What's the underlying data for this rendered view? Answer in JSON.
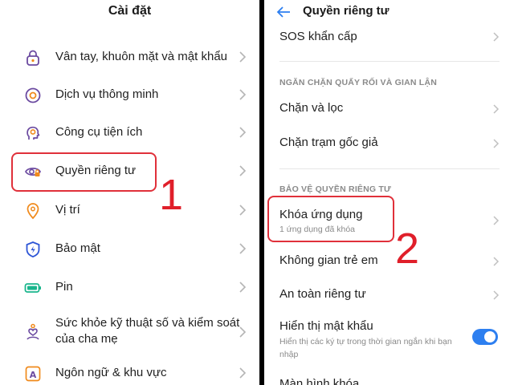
{
  "left": {
    "title": "Cài đặt",
    "items": [
      {
        "label": "Vân tay, khuôn mặt và mật khẩu",
        "icon": "lock-icon"
      },
      {
        "label": "Dịch vụ thông minh",
        "icon": "circle-target-icon"
      },
      {
        "label": "Công cụ tiện ích",
        "icon": "head-gear-icon"
      },
      {
        "label": "Quyền riêng tư",
        "icon": "eye-lock-icon"
      },
      {
        "label": "Vị trí",
        "icon": "location-pin-icon"
      },
      {
        "label": "Bảo mật",
        "icon": "shield-bolt-icon"
      },
      {
        "label": "Pin",
        "icon": "battery-icon"
      },
      {
        "label": "Sức khỏe kỹ thuật số và kiểm soát của cha mẹ",
        "icon": "heart-person-icon"
      },
      {
        "label": "Ngôn ngữ & khu vực",
        "icon": "language-icon"
      }
    ],
    "step_number": "1"
  },
  "right": {
    "title": "Quyền riêng tư",
    "sos": "SOS khẩn cấp",
    "section1_header": "NGĂN CHẶN QUẤY RỐI VÀ GIAN LẬN",
    "block_filter": "Chặn và lọc",
    "block_fake_station": "Chặn trạm gốc giả",
    "section2_header": "BẢO VỆ QUYỀN RIÊNG TƯ",
    "app_lock": "Khóa ứng dụng",
    "app_lock_sub": "1 ứng dụng đã khóa",
    "kids_space": "Không gian trẻ em",
    "private_safe": "An toàn riêng tư",
    "show_password": "Hiển thị mật khẩu",
    "show_password_sub": "Hiển thị các ký tự trong thời gian ngắn khi bạn nhập",
    "show_password_on": true,
    "lock_screen": "Màn hình khóa",
    "step_number": "2"
  },
  "colors": {
    "highlight": "#e0303a",
    "icon_purple": "#6b4aa0",
    "icon_orange": "#f08a1c",
    "icon_blue": "#2d55d6",
    "icon_green": "#19b58c",
    "toggle_on": "#2d7ff0"
  }
}
